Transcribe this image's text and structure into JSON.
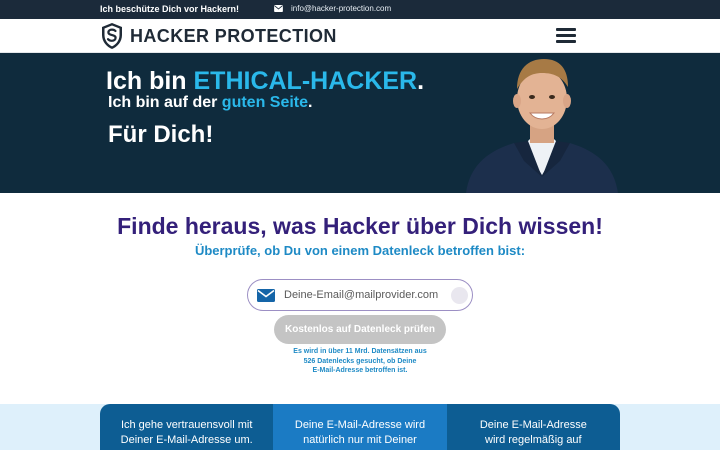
{
  "topbar": {
    "slogan": "Ich beschütze Dich vor Hackern!",
    "email": "info@hacker-protection.com"
  },
  "header": {
    "logo_text": "HACKER PROTECTION"
  },
  "hero": {
    "line1_prefix": "Ich bin ",
    "line1_highlight": "ETHICAL-HACKER",
    "line1_suffix": ".",
    "line2_prefix": "Ich bin auf der ",
    "line2_highlight": "guten Seite",
    "line2_suffix": ".",
    "line3": "Für Dich!"
  },
  "check": {
    "title": "Finde heraus, was Hacker über Dich wissen!",
    "subtitle": "Überprüfe, ob Du von einem Datenleck betroffen bist:",
    "email_placeholder": "Deine-Email@mailprovider.com",
    "button_label": "Kostenlos auf Datenleck prüfen",
    "note_line1": "Es wird in über 11 Mrd. Datensätzen aus",
    "note_line2": "526 Datenlecks gesucht, ob Deine",
    "note_line3": "E-Mail-Adresse betroffen ist."
  },
  "cards": [
    {
      "line1": "Ich gehe vertrauensvoll mit",
      "line2": "Deiner E-Mail-Adresse um."
    },
    {
      "line1": "Deine E-Mail-Adresse wird",
      "line2": "natürlich nur mit Deiner"
    },
    {
      "line1": "Deine E-Mail-Adresse",
      "line2": "wird regelmäßig auf"
    }
  ],
  "colors": {
    "brand_dark": "#0f2b3d",
    "accent_cyan": "#2ab8ea",
    "title_purple": "#34207a",
    "subtitle_blue": "#1e8ac5",
    "card_dark": "#0d5d93",
    "card_mid": "#1b7bc4"
  },
  "icons": {
    "topbar_mail": "envelope-icon",
    "logo": "shield-s-icon",
    "menu": "hamburger-menu-icon",
    "input_mail": "envelope-icon"
  }
}
